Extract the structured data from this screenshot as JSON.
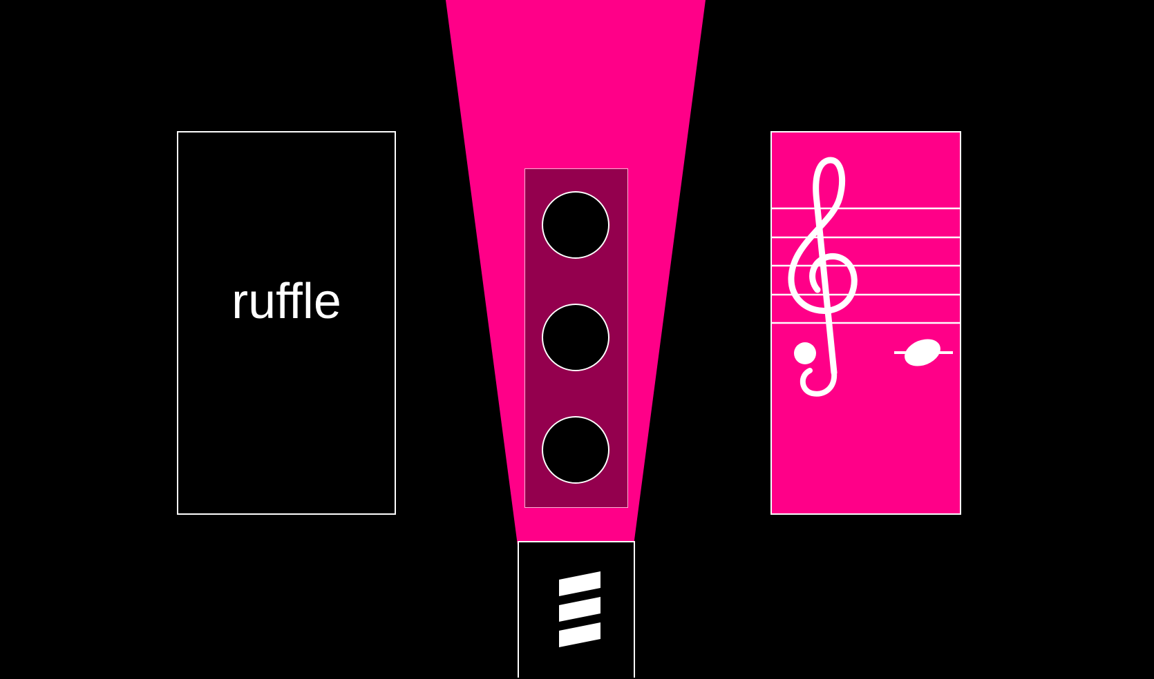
{
  "scene": {
    "background_color": "#000000",
    "beam_color": "#ff0088"
  },
  "cards": {
    "left": {
      "word": "ruffle",
      "background_color": "#000000",
      "border_color": "#ffffff"
    },
    "middle": {
      "background_color": "#94004e",
      "dot_count": 3,
      "icon": "three-dots-icon"
    },
    "right": {
      "background_color": "#ff0088",
      "icon": "treble-clef-staff-note-icon",
      "staff_line_count": 5
    },
    "bottom": {
      "background_color": "#000000",
      "icon": "three-stripes-logo-icon",
      "stripe_count": 3
    }
  }
}
